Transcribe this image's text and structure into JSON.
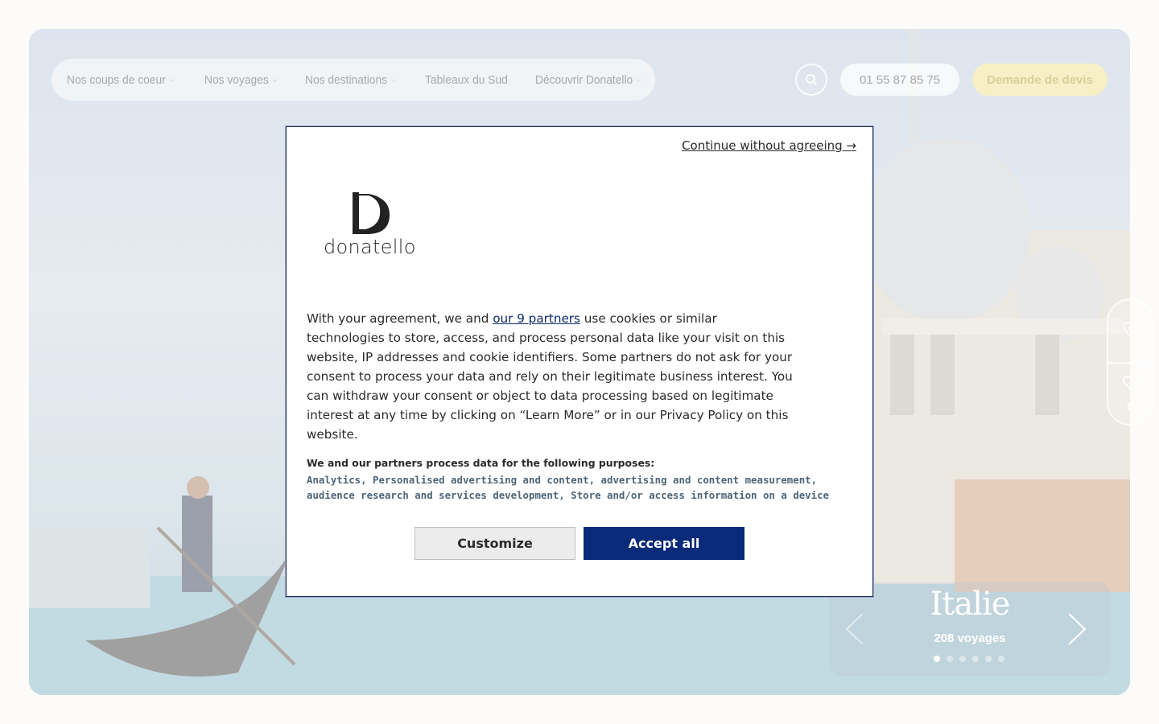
{
  "nav": {
    "items": [
      {
        "label": "Nos coups de coeur",
        "dropdown": true
      },
      {
        "label": "Nos voyages",
        "dropdown": true
      },
      {
        "label": "Nos destinations",
        "dropdown": true
      },
      {
        "label": "Tableaux du Sud",
        "dropdown": false
      },
      {
        "label": "Découvrir Donatello",
        "dropdown": true
      }
    ],
    "search_icon": "search-icon",
    "phone_label": "01 55 87 85 75",
    "quote_label": "Demande de devis"
  },
  "side_widget": {
    "phone_icon": "phone-icon",
    "heart_icon": "heart-icon",
    "favorites_count": "0"
  },
  "carousel": {
    "title": "Italie",
    "count": "208 voyages",
    "dots_total": 6,
    "active_dot": 0
  },
  "consent": {
    "continue_label": "Continue without agreeing →",
    "logo_text": "donatello",
    "intro_before_link": "With your agreement, we and ",
    "partners_link": "our 9 partners",
    "intro_after_link": " use cookies or similar technologies to store, access, and process personal data like your visit on this website, IP addresses and cookie identifiers. Some partners do not ask for your consent to process your data and rely on their legitimate business interest. You can withdraw your consent or object to data processing based on legitimate interest at any time by clicking on “Learn More” or in our Privacy Policy on this website.",
    "purposes_heading": "We and our partners process data for the following purposes:",
    "purposes_list": "Analytics, Personalised advertising and content, advertising and content measurement, audience research and services development, Store and/or access information on a device",
    "customize_label": "Customize",
    "accept_label": "Accept all"
  },
  "colors": {
    "accept_bg": "#0a2a7a",
    "quote_bg": "#f7efc6",
    "modal_border": "#1f2f5f"
  }
}
